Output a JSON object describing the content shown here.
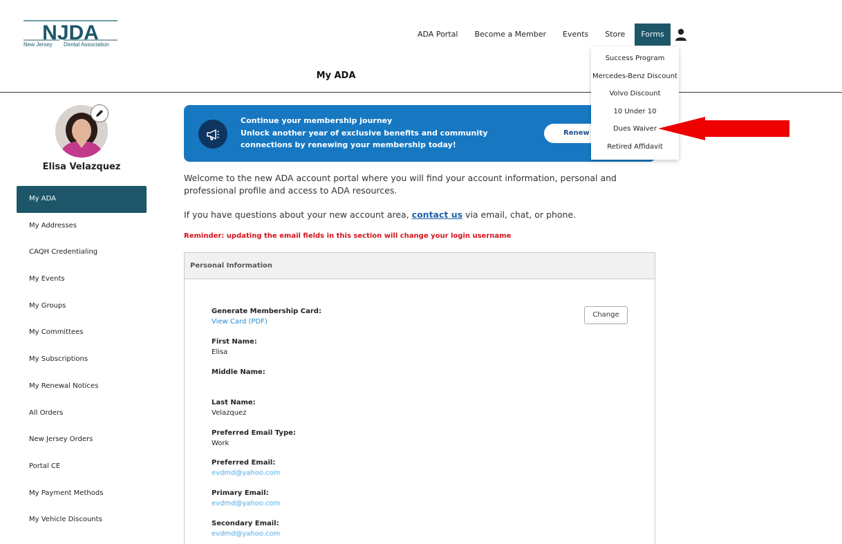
{
  "header": {
    "logo_text": "NJDA",
    "logo_subtext_left": "New Jersey",
    "logo_subtext_right": "Dental Association",
    "page_title": "My ADA"
  },
  "topnav": {
    "items": [
      "ADA Portal",
      "Become a Member",
      "Events",
      "Store"
    ],
    "forms_label": "Forms",
    "user_icon": "person-icon"
  },
  "forms_menu": {
    "items": [
      "Success Program",
      "Mercedes-Benz Discount",
      "Volvo Discount",
      "10 Under 10",
      "Dues Waiver",
      "Retired Affidavit"
    ]
  },
  "sidebar": {
    "user_name": "Elisa Velazquez",
    "items": [
      "My ADA",
      "My Addresses",
      "CAQH Credentialing",
      "My Events",
      "My Groups",
      "My Committees",
      "My Subscriptions",
      "My Renewal Notices",
      "All Orders",
      "New Jersey Orders",
      "Portal CE",
      "My Payment Methods",
      "My Vehicle Discounts"
    ],
    "active_index": 0
  },
  "banner": {
    "title": "Continue your membership journey",
    "text": "Unlock another year of exclusive benefits and community connections by renewing your membership today!",
    "button_label": "Renew n",
    "icon": "megaphone-icon"
  },
  "intro": {
    "welcome": "Welcome to the new ADA account portal where you will find your account information, personal and professional profile and access to ADA resources.",
    "questions_prefix": "If you have questions about your new account area,",
    "contact_link": "contact us",
    "questions_suffix": "via email, chat, or phone.",
    "reminder": "Reminder: updating the email fields in this section will change your login username"
  },
  "personal_info": {
    "heading": "Personal Information",
    "change_label": "Change",
    "membership_card_label": "Generate Membership Card:",
    "membership_card_link": "View Card (PDF)",
    "first_name_label": "First Name:",
    "first_name": "Elisa",
    "middle_name_label": "Middle Name:",
    "middle_name": "",
    "last_name_label": "Last Name:",
    "last_name": "Velazquez",
    "email_type_label": "Preferred Email Type:",
    "email_type": "Work",
    "preferred_email_label": "Preferred Email:",
    "preferred_email": "evdmd@yahoo.com",
    "primary_email_label": "Primary Email:",
    "primary_email": "evdmd@yahoo.com",
    "secondary_email_label": "Secondary Email:",
    "secondary_email": "evdmd@yahoo.com"
  },
  "colors": {
    "primary_teal": "#1d5669",
    "banner_blue": "#1778c1",
    "reminder_red": "#d4111b",
    "annotation_arrow": "#ee0000"
  }
}
